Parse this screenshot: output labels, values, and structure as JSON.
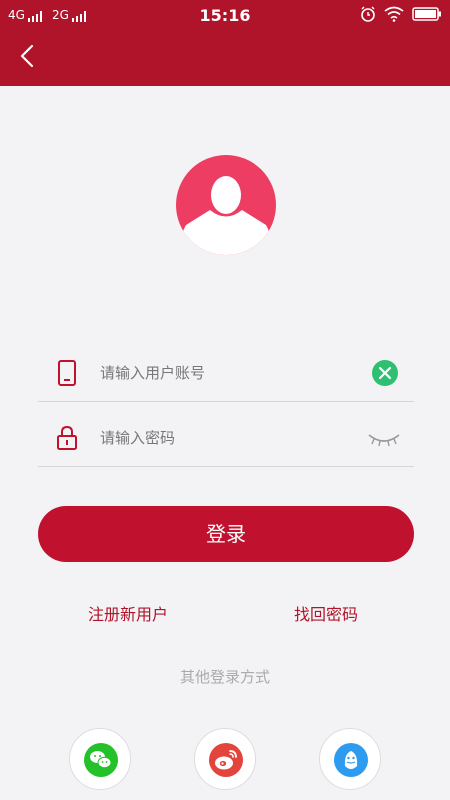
{
  "status_bar": {
    "network1": "4G",
    "network2": "2G",
    "time": "15:16"
  },
  "nav": {
    "back_icon": "chevron-left-icon"
  },
  "avatar": {
    "icon": "user-silhouette-icon"
  },
  "form": {
    "account_placeholder": "请输入用户账号",
    "password_placeholder": "请输入密码",
    "login_label": "登录"
  },
  "links": {
    "register": "注册新用户",
    "forgot": "找回密码"
  },
  "other_login": {
    "label": "其他登录方式",
    "providers": [
      "wechat-icon",
      "weibo-icon",
      "qq-icon"
    ]
  },
  "colors": {
    "brand": "#b0142a",
    "button": "#c0122f",
    "avatar": "#ee3d62",
    "clear": "#2fbf71",
    "wechat": "#25c12b",
    "weibo": "#e3443b",
    "qq": "#2d9cf0"
  }
}
